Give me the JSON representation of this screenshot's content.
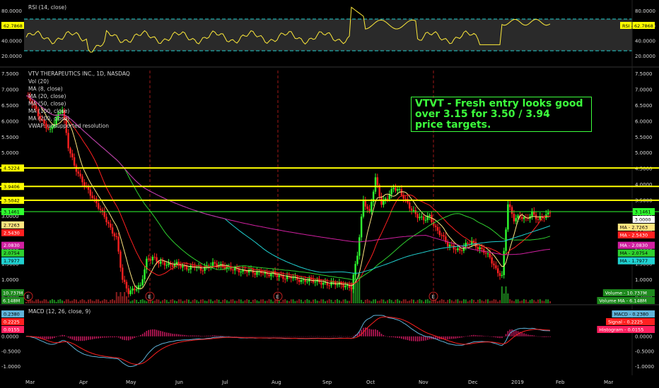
{
  "panels": {
    "rsi": {
      "title": "RSI (14, close)",
      "ticks": [
        "80.0000",
        "60.0000",
        "40.0000",
        "20.0000"
      ],
      "level_upper": 70,
      "level_lower": 30,
      "current_label": "62.7868",
      "current": 62.7868
    },
    "main": {
      "title": "VTV THERAPEUTICS INC., 1D, NASDAQ",
      "legend": [
        "Vol (20)",
        "MA (8, close)",
        "MA (20, close)",
        "MA (50, close)",
        "MA (100, close)",
        "MA (200, close)",
        "VWAP: unsupported resolution"
      ],
      "price_ticks": [
        "7.5000",
        "7.0000",
        "6.5000",
        "6.0000",
        "5.5000",
        "5.0000",
        "4.5000",
        "4.0000",
        "3.5000",
        "3.0000",
        "2.5000",
        "2.0000",
        "1.5000",
        "1.0000",
        "0.5000"
      ],
      "earnings_marker": "E",
      "annotation": "VTVT - Fresh entry looks good\nover 3.15 for 3.50 / 3.94\nprice targets."
    },
    "macd": {
      "title": "MACD (12, 26, close, 9)",
      "ticks": [
        "0.5000",
        "0.0000",
        "-0.5000",
        "-1.0000"
      ]
    }
  },
  "x_axis": {
    "labels": [
      "Mar",
      "Apr",
      "May",
      "Jun",
      "Jul",
      "Aug",
      "Sep",
      "Oct",
      "Nov",
      "Dec",
      "2019",
      "Feb",
      "Mar"
    ]
  },
  "chart_data": {
    "type": "candlestick",
    "symbol": "VTVT",
    "timeframe": "1D",
    "horizontal_levels": [
      {
        "value": 4.5224,
        "label": "4.5224",
        "color": "#ffff00"
      },
      {
        "value": 3.9406,
        "label": "3.9406",
        "color": "#ffff00"
      },
      {
        "value": 3.5042,
        "label": "3.5042",
        "color": "#ffff00"
      },
      {
        "value": 3.1461,
        "label": "3.1461",
        "color": "#2fff2f"
      }
    ],
    "price_badges_right": [
      {
        "text": "3.1461",
        "value": 3.1461,
        "bg": "#2fff2f",
        "fg": "#000000"
      },
      {
        "text": "3.0000",
        "value": 3.0,
        "bg": "#ffffff",
        "fg": "#000000"
      },
      {
        "text": "MA - 2.7263",
        "value": 2.7263,
        "bg": "#ffe680",
        "fg": "#000000"
      },
      {
        "text": "MA - 2.5430",
        "value": 2.543,
        "bg": "#ff2020",
        "fg": "#ffffff"
      },
      {
        "text": "MA - 2.0830",
        "value": 2.083,
        "bg": "#d020a0",
        "fg": "#ffffff"
      },
      {
        "text": "MA - 2.0754",
        "value": 2.0754,
        "bg": "#2fd02f",
        "fg": "#000000"
      },
      {
        "text": "MA - 1.7977",
        "value": 1.7977,
        "bg": "#20d0d0",
        "fg": "#000000"
      }
    ],
    "price_badges_left": [
      {
        "text": "4.5224",
        "value": 4.5224,
        "bg": "#ffff00",
        "fg": "#000000"
      },
      {
        "text": "3.9406",
        "value": 3.9406,
        "bg": "#ffff00",
        "fg": "#000000"
      },
      {
        "text": "3.5042",
        "value": 3.5042,
        "bg": "#ffff00",
        "fg": "#000000"
      },
      {
        "text": "3.1461",
        "value": 3.1461,
        "bg": "#2fff2f",
        "fg": "#000000"
      },
      {
        "text": "2.7263",
        "value": 2.7263,
        "bg": "#ffe680",
        "fg": "#000000"
      },
      {
        "text": "2.5430",
        "value": 2.543,
        "bg": "#ff2020",
        "fg": "#ffffff"
      },
      {
        "text": "2.0830",
        "value": 2.083,
        "bg": "#d020a0",
        "fg": "#ffffff"
      },
      {
        "text": "2.0754",
        "value": 2.0754,
        "bg": "#2fd02f",
        "fg": "#000000"
      },
      {
        "text": "1.7977",
        "value": 1.7977,
        "bg": "#20d0d0",
        "fg": "#000000"
      }
    ],
    "volume_badges": {
      "right": [
        {
          "text": "Volume - 10.737M"
        },
        {
          "text": "Volume MA - 6.148M"
        }
      ],
      "left": [
        {
          "text": "10.737M"
        },
        {
          "text": "6.148M"
        }
      ]
    },
    "macd_badges": {
      "right": [
        {
          "text": "MACD - 0.2380",
          "value": 0.238,
          "bg": "#5fb3d9",
          "fg": "#000000"
        },
        {
          "text": "Signal - 0.2225",
          "value": 0.2225,
          "bg": "#ff2020",
          "fg": "#ffffff"
        },
        {
          "text": "Histogram - 0.0155",
          "value": 0.0155,
          "bg": "#ff2060",
          "fg": "#ffffff"
        }
      ],
      "left": [
        {
          "text": "0.2380",
          "value": 0.238,
          "bg": "#5fb3d9",
          "fg": "#000000"
        },
        {
          "text": "0.2225",
          "value": 0.2225,
          "bg": "#ff2020",
          "fg": "#ffffff"
        },
        {
          "text": "0.0155",
          "value": 0.0155,
          "bg": "#ff2060",
          "fg": "#ffffff"
        }
      ]
    },
    "close_series": [
      6.8,
      6.6,
      6.2,
      5.9,
      5.7,
      6.1,
      6.4,
      5.2,
      4.6,
      4.2,
      3.9,
      3.6,
      3.3,
      3.0,
      2.6,
      2.3,
      1.0,
      0.6,
      0.7,
      0.8,
      1.6,
      1.7,
      1.55,
      1.5,
      1.45,
      1.5,
      1.4,
      1.35,
      1.45,
      1.3,
      1.4,
      1.5,
      1.45,
      1.4,
      1.35,
      1.3,
      1.25,
      1.3,
      1.2,
      1.25,
      1.15,
      1.2,
      1.1,
      1.05,
      1.1,
      1.0,
      0.95,
      1.0,
      0.95,
      0.9,
      0.85,
      0.9,
      0.85,
      0.8,
      0.75,
      1.8,
      3.5,
      3.1,
      4.2,
      3.4,
      3.6,
      3.9,
      3.8,
      3.5,
      3.2,
      3.0,
      2.9,
      3.0,
      2.6,
      2.4,
      2.1,
      2.0,
      1.9,
      2.1,
      2.2,
      2.0,
      1.9,
      1.7,
      1.3,
      1.1,
      3.4,
      2.9,
      3.0,
      2.9,
      3.1,
      2.9,
      3.0,
      3.1
    ],
    "ma_colors": {
      "ma8": "#ffe680",
      "ma20": "#ff2020",
      "ma50": "#2fd02f",
      "ma100": "#20d0d0",
      "ma200": "#d020a0"
    },
    "rsi_range": [
      10,
      90
    ],
    "price_range": [
      0.25,
      7.6
    ],
    "macd_range": [
      -1.25,
      0.7
    ]
  }
}
